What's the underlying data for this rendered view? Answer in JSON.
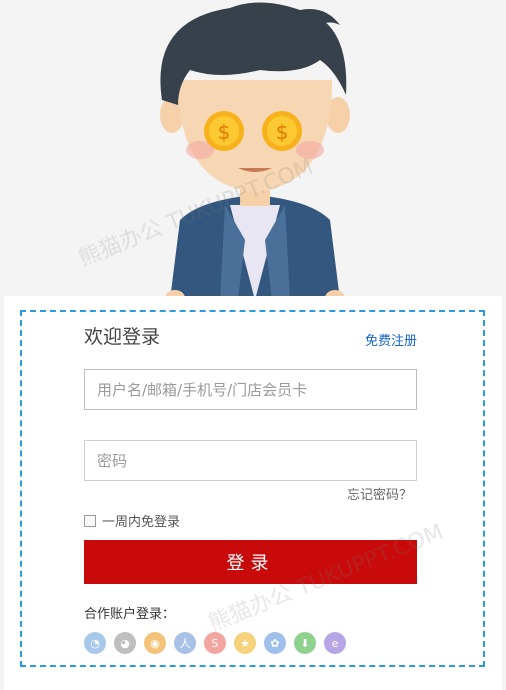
{
  "login": {
    "title": "欢迎登录",
    "register_label": "免费注册",
    "username_placeholder": "用户名/邮箱/手机号/门店会员卡",
    "password_placeholder": "密码",
    "forgot_label": "忘记密码？",
    "remember_label": "一周内免登录",
    "submit_label": "登录",
    "partner_label": "合作账户登录："
  },
  "social_icons": [
    {
      "name": "qq-icon",
      "color": "#a7c8ea",
      "glyph": "◔"
    },
    {
      "name": "wechat-icon",
      "color": "#bfbfbf",
      "glyph": "◕"
    },
    {
      "name": "weibo-icon",
      "color": "#f5c27a",
      "glyph": "◉"
    },
    {
      "name": "renren-icon",
      "color": "#a9c1e6",
      "glyph": "人"
    },
    {
      "name": "alipay-icon",
      "color": "#f3a6a0",
      "glyph": "S"
    },
    {
      "name": "star-icon",
      "color": "#f6d27c",
      "glyph": "★"
    },
    {
      "name": "baidu-icon",
      "color": "#9fc0ea",
      "glyph": "✿"
    },
    {
      "name": "download-icon",
      "color": "#8fd18f",
      "glyph": "⬇"
    },
    {
      "name": "360-icon",
      "color": "#b7a6e6",
      "glyph": "e"
    }
  ],
  "colors": {
    "accent": "#c80a0a",
    "link": "#1565c0",
    "dashed_border": "#2a9be0"
  },
  "watermark": "熊猫办公 TUKUPPT.COM"
}
